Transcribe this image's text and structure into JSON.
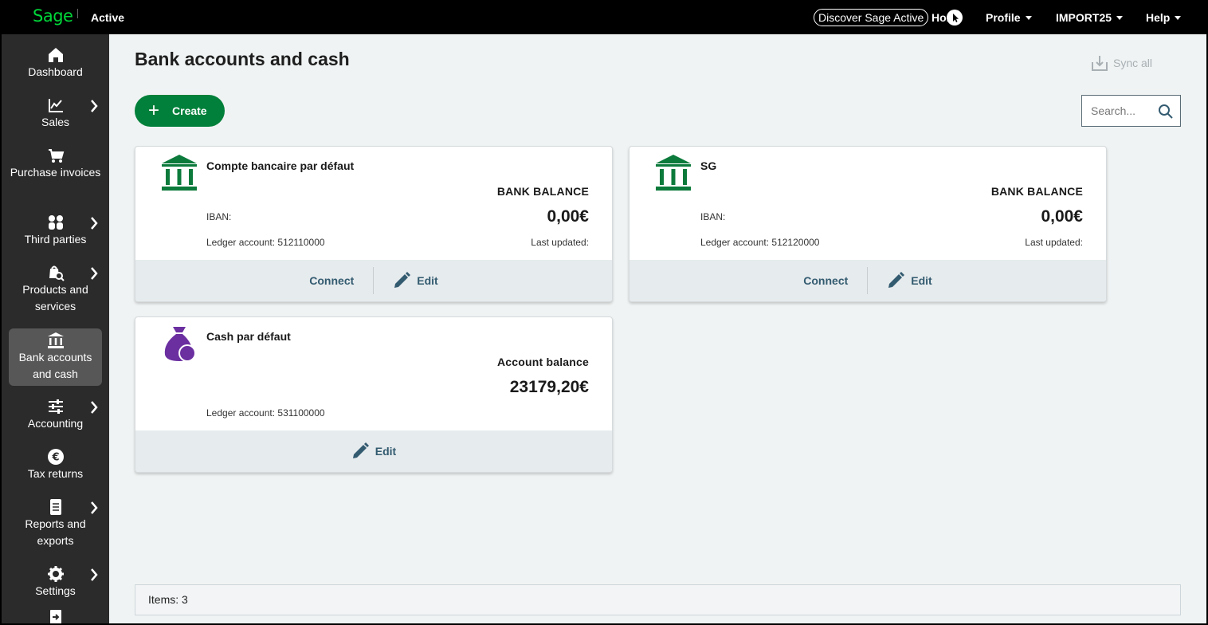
{
  "topbar": {
    "logo": "Sage",
    "product": "Active",
    "discover_label": "Discover Sage Active",
    "home_label": "Home",
    "nav": [
      {
        "label": "Profile"
      },
      {
        "label": "IMPORT25"
      },
      {
        "label": "Help"
      }
    ]
  },
  "sidebar": {
    "items": [
      {
        "label": "Dashboard",
        "icon": "home-icon",
        "has_submenu": false
      },
      {
        "label": "Sales",
        "icon": "chart-icon",
        "has_submenu": true
      },
      {
        "label": "Purchase invoices",
        "icon": "cart-icon",
        "has_submenu": false
      },
      {
        "label": "Third parties",
        "icon": "people-icon",
        "has_submenu": true
      },
      {
        "label": "Products and services",
        "icon": "product-search-icon",
        "has_submenu": true
      },
      {
        "label": "Bank accounts and cash",
        "icon": "bank-icon",
        "has_submenu": false,
        "active": true
      },
      {
        "label": "Accounting",
        "icon": "sliders-icon",
        "has_submenu": true
      },
      {
        "label": "Tax returns",
        "icon": "euro-icon",
        "has_submenu": false
      },
      {
        "label": "Reports and exports",
        "icon": "report-icon",
        "has_submenu": true
      },
      {
        "label": "Settings",
        "icon": "gear-icon",
        "has_submenu": true
      }
    ]
  },
  "page": {
    "title": "Bank accounts and cash",
    "sync_label": "Sync all",
    "create_label": "Create",
    "search_placeholder": "Search..."
  },
  "cards": [
    {
      "name": "Compte bancaire par défaut",
      "type": "bank",
      "balance_label": "BANK BALANCE",
      "balance": "0,00€",
      "iban": "IBAN:",
      "ledger": "Ledger account: 512110000",
      "last_updated": "Last updated:",
      "connect_label": "Connect",
      "edit_label": "Edit"
    },
    {
      "name": "SG",
      "type": "bank",
      "balance_label": "BANK BALANCE",
      "balance": "0,00€",
      "iban": "IBAN:",
      "ledger": "Ledger account: 512120000",
      "last_updated": "Last updated:",
      "connect_label": "Connect",
      "edit_label": "Edit"
    },
    {
      "name": "Cash par défaut",
      "type": "cash",
      "balance_label": "Account balance",
      "balance": "23179,20€",
      "ledger": "Ledger account: 531100000",
      "edit_label": "Edit"
    }
  ],
  "footer": {
    "items_label": "Items: 3"
  },
  "colors": {
    "brand_green": "#00803a",
    "logo_green": "#00d639",
    "bank_icon": "#0b7a3b",
    "cash_icon": "#6b2fa0",
    "footer_text": "#335b70"
  }
}
